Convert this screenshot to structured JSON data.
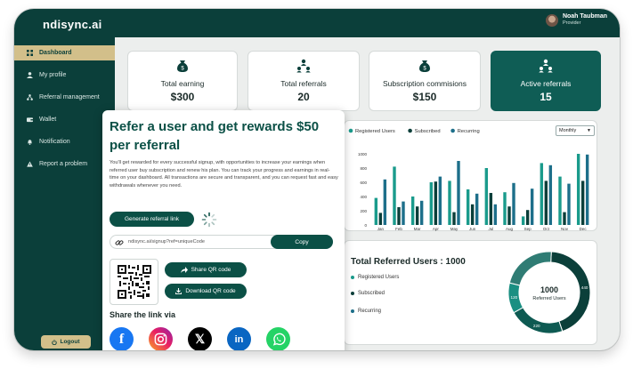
{
  "app": {
    "logo": "ndisync.ai"
  },
  "user": {
    "name": "Noah Taubman",
    "role": "Provider"
  },
  "sidebar": {
    "items": [
      {
        "label": "Dashboard",
        "icon": "grid-icon",
        "active": true
      },
      {
        "label": "My profile",
        "icon": "user-icon"
      },
      {
        "label": "Referral management",
        "icon": "network-icon"
      },
      {
        "label": "Wallet",
        "icon": "wallet-icon"
      },
      {
        "label": "Notification",
        "icon": "bell-icon"
      },
      {
        "label": "Report a problem",
        "icon": "warning-icon"
      }
    ],
    "logout": "Logout"
  },
  "stats": [
    {
      "label": "Total earning",
      "value": "$300",
      "icon": "money-bag-icon"
    },
    {
      "label": "Total referrals",
      "value": "20",
      "icon": "people-network-icon"
    },
    {
      "label": "Subscription commisions",
      "value": "$150",
      "icon": "money-bag-icon"
    },
    {
      "label": "Active referrals",
      "value": "15",
      "icon": "people-network-icon"
    }
  ],
  "chart": {
    "period": "Monthly",
    "legend": [
      "Registered Users",
      "Subscribed",
      "Recurring"
    ],
    "colors": [
      "#1a9b8c",
      "#0b3f3a",
      "#1d6f8a"
    ]
  },
  "chart_data": {
    "type": "bar",
    "categories": [
      "Jan",
      "Feb",
      "Mar",
      "Apr",
      "May",
      "Jun",
      "Jul",
      "Aug",
      "Sep",
      "Oct",
      "Nov",
      "Dec"
    ],
    "ylim": [
      0,
      1000
    ],
    "yticks": [
      "1000",
      "800",
      "600",
      "400",
      "200",
      "0"
    ],
    "series": [
      {
        "name": "Registered Users",
        "values": [
          380,
          820,
          400,
          600,
          620,
          500,
          800,
          460,
          120,
          870,
          680,
          1000
        ]
      },
      {
        "name": "Subscribed",
        "values": [
          170,
          250,
          260,
          610,
          180,
          290,
          450,
          260,
          210,
          620,
          180,
          620
        ]
      },
      {
        "name": "Recurring",
        "values": [
          640,
          330,
          340,
          680,
          900,
          440,
          290,
          590,
          510,
          840,
          580,
          990
        ]
      }
    ]
  },
  "referred": {
    "title": "Total Referred Users : 1000",
    "legend": [
      "Registered Users",
      "Subscribed",
      "Recurring"
    ],
    "center_value": "1000",
    "center_label": "Referred Users",
    "segments": [
      {
        "label": "440",
        "value": 440,
        "color": "#0b3f3a"
      },
      {
        "label": "220",
        "value": 220,
        "color": "#0e5a52"
      },
      {
        "label": "120",
        "value": 120,
        "color": "#1a8f82"
      },
      {
        "label": "",
        "value": 220,
        "color": "#2f7c74"
      }
    ]
  },
  "modal": {
    "title": "Refer a user and get rewards $50 per referral",
    "description": "You'll get rewarded for every successful signup, with opportunities to increase your earnings when referred user buy subscription and renew his plan. You can track your progress and earnings in real-time on your dashboard. All transactions are secure and transparent, and you can request fast and easy withdrawals whenever you need.",
    "generate": "Generate referral link",
    "link": "ndisync.ai/signup?ref=uniqueCode",
    "copy": "Copy",
    "share_qr": "Share QR code",
    "download_qr": "Download QR code",
    "share_via": "Share the link via",
    "socials": [
      "facebook-icon",
      "instagram-icon",
      "x-icon",
      "linkedin-icon",
      "whatsapp-icon"
    ]
  }
}
